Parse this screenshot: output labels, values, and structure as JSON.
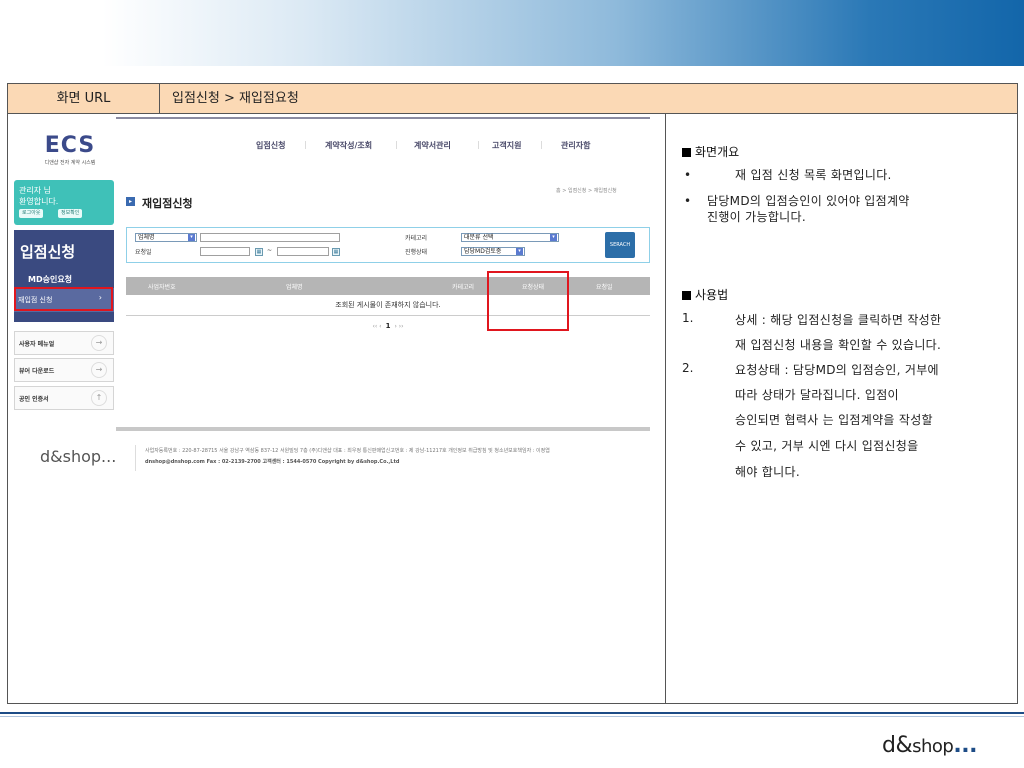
{
  "header": {
    "label": "화면 URL",
    "value": "입점신청 > 재입점요청"
  },
  "mock": {
    "logo_title": "ECS",
    "logo_sub": "디앤샵 전자 계약 시스템",
    "nav": [
      "입점신청",
      "계약작성/조회",
      "계약서관리",
      "고객지원",
      "관리자함"
    ],
    "greet_l1": "관리자 님",
    "greet_l2": "환영합니다.",
    "logout": "로그아웃",
    "info": "정보확인",
    "side_title": "입점신청",
    "side_item1": "MD승인요청",
    "side_item2": "재입점 신청",
    "quick": [
      "사용자 메뉴얼",
      "뷰어 다운로드",
      "공인 인증서"
    ],
    "page_title": "재입점신청",
    "breadcrumb": "홈 > 입점신청 > 재입점신청",
    "search": {
      "field1": "업체명",
      "field2": "요청일",
      "tilde": "~",
      "cat_label": "카테고리",
      "cat_value": "대분류 선택",
      "status_label": "진행상태",
      "status_value": "담당MD검토중",
      "btn": "SERACH"
    },
    "table_headers": [
      "사업자번호",
      "업체명",
      "카테고리",
      "요청상태",
      "요청일"
    ],
    "empty": "조회된 게시물이 존재하지 않습니다.",
    "pager_prev": "‹‹ ‹",
    "pager_page": "1",
    "pager_next": "› ››",
    "footer_logo": "d&shop...",
    "footer_l1": "사업자등록번호 : 220-87-28715  서울 강남구 역삼동 837-12 서원빌딩 7층 (주)디앤샵 대표 : 최우정 통신판매업신고번호 : 제 강남-11217호 개인정보 취급방침 및 청소년보호책임자 : 이정엽",
    "footer_l2": "dnshop@dnshop.com Fax : 02-2139-2700 고객센터 : 1544-0570 Copyright by d&shop.Co.,Ltd"
  },
  "desc": {
    "overview_title": "화면개요",
    "overview_bullets": [
      "재 입점 신청 목록 화면입니다.",
      "담당MD의 입점승인이 있어야 입점계약",
      "진행이 가능합니다."
    ],
    "usage_title": "사용법",
    "usage1_num": "1.",
    "usage1_lines": [
      "상세 : 해당 입점신청을 클릭하면 작성한",
      "재 입점신청 내용을 확인할 수 있습니다."
    ],
    "usage2_num": "2.",
    "usage2_lines": [
      "요청상태 : 담당MD의 입점승인, 거부에",
      "따라 상태가 달라집니다. 입점이",
      "승인되면 협력사 는 입점계약을 작성할",
      "수 있고, 거부 시엔 다시 입점신청을",
      "해야 합니다."
    ],
    "bullet": "•"
  },
  "corner_logo": {
    "d": "d",
    "amp": "&",
    "shop": "shop",
    "dots": "..."
  }
}
